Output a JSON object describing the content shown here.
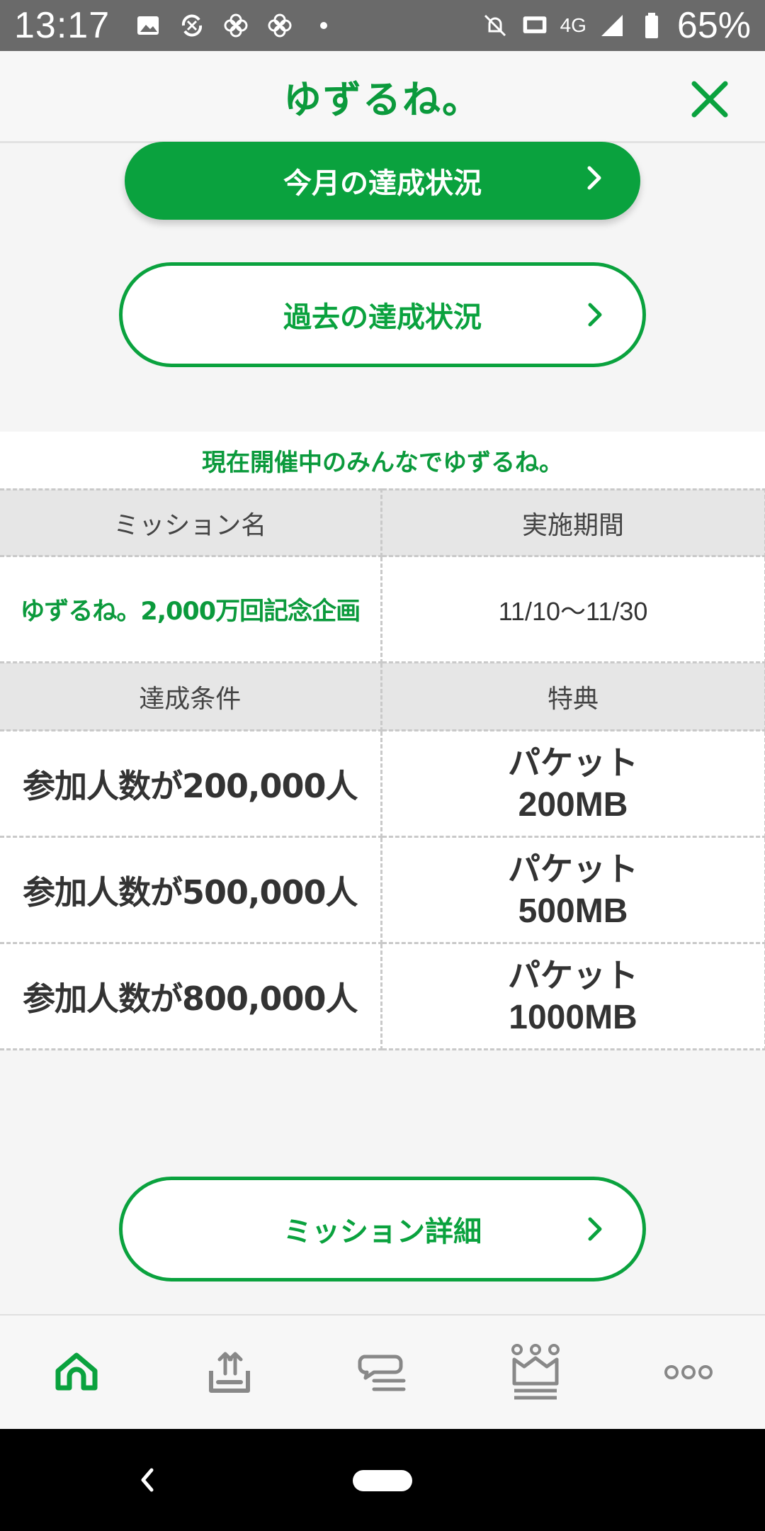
{
  "status_bar": {
    "time": "13:17",
    "network": "4G",
    "battery": "65%",
    "icons": [
      "image-icon",
      "sync-icon",
      "pinwheel-icon",
      "pinwheel-icon",
      "dot-icon",
      "mute-icon",
      "cast-icon",
      "signal-icon",
      "battery-icon"
    ]
  },
  "header": {
    "title": "ゆずるね。",
    "close_icon": "close-icon"
  },
  "buttons": {
    "current_month": "今月の達成状況",
    "past": "過去の達成状況",
    "mission_detail": "ミッション詳細"
  },
  "section": {
    "caption": "現在開催中のみんなでゆずるね。"
  },
  "table": {
    "head1": [
      "ミッション名",
      "実施期間"
    ],
    "mission": {
      "name": "ゆずるね。2,000万回記念企画",
      "period": "11/10〜11/30"
    },
    "head2": [
      "達成条件",
      "特典"
    ],
    "rows": [
      {
        "condition": "参加人数が200,000人",
        "reward_line1": "パケット",
        "reward_line2": "200MB"
      },
      {
        "condition": "参加人数が500,000人",
        "reward_line1": "パケット",
        "reward_line2": "500MB"
      },
      {
        "condition": "参加人数が800,000人",
        "reward_line1": "パケット",
        "reward_line2": "1000MB"
      }
    ]
  },
  "bottom_nav": {
    "items": [
      "home-icon",
      "upload-tray-icon",
      "chat-icon",
      "crown-icon",
      "more-icon"
    ],
    "active": "home-icon"
  },
  "colors": {
    "brand_green": "#0aa23e",
    "text_dark": "#333333",
    "header_bg": "#e6e6e6",
    "status_bar": "#6a6a6a"
  }
}
